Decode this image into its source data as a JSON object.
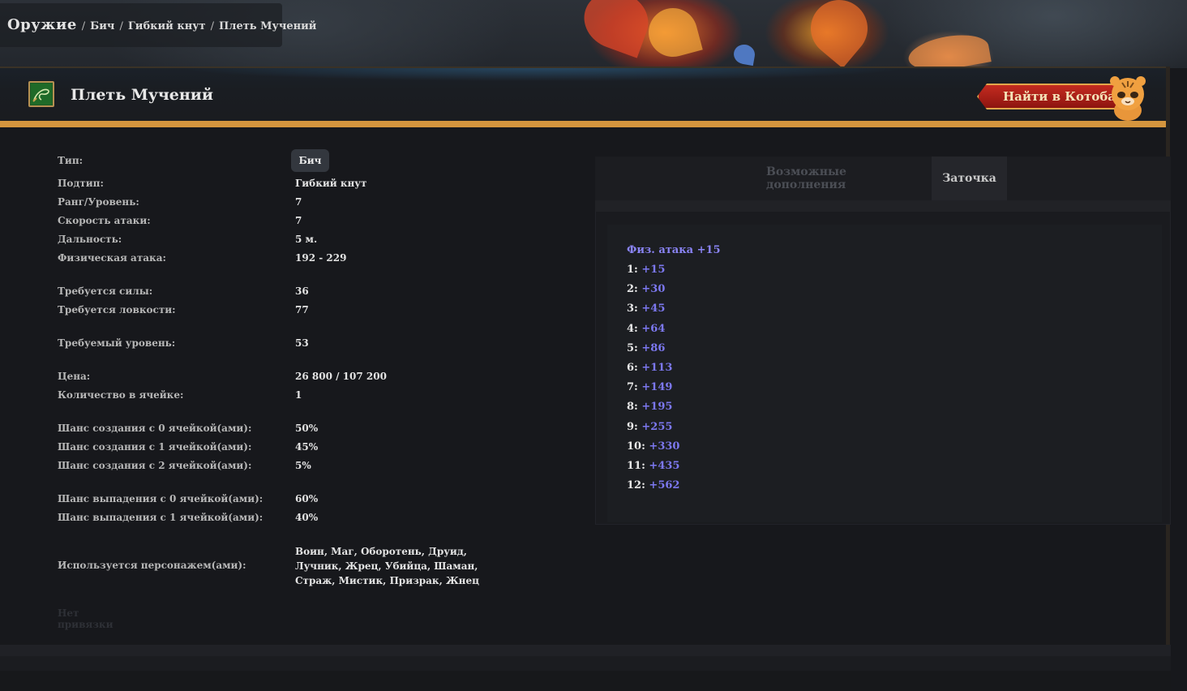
{
  "breadcrumb": {
    "root": "Оружие",
    "items": [
      "Бич",
      "Гибкий кнут",
      "Плеть Мучений"
    ],
    "separator": "/"
  },
  "item": {
    "title": "Плеть Мучений",
    "icon": "whip-item-icon",
    "find_button": "Найти в Котобазе"
  },
  "props": {
    "type_label": "Тип:",
    "type_value": "Бич",
    "subtype_label": "Подтип:",
    "subtype_value": "Гибкий кнут",
    "rank_label": "Ранг/Уровень:",
    "rank_value": "7",
    "speed_label": "Скорость атаки:",
    "speed_value": "7",
    "range_label": "Дальность:",
    "range_value": "5 м.",
    "attack_label": "Физическая атака:",
    "attack_value": "192 - 229",
    "str_label": "Требуется силы:",
    "str_value": "36",
    "agi_label": "Требуется ловкости:",
    "agi_value": "77",
    "level_label": "Требуемый уровень:",
    "level_value": "53",
    "price_label": "Цена:",
    "price_value": "26 800 / 107 200",
    "cell_count_label": "Количество в ячейке:",
    "cell_count_value": "1",
    "craft0_label": "Шанс создания с 0 ячейкой(ами):",
    "craft0_value": "50%",
    "craft1_label": "Шанс создания с 1 ячейкой(ами):",
    "craft1_value": "45%",
    "craft2_label": "Шанс создания с 2 ячейкой(ами):",
    "craft2_value": "5%",
    "drop0_label": "Шанс выпадения с 0 ячейкой(ами):",
    "drop0_value": "60%",
    "drop1_label": "Шанс выпадения с 1 ячейкой(ами):",
    "drop1_value": "40%",
    "classes_label": "Используется персонажем(ами):",
    "classes_value": "Воин, Маг, Оборотень, Друид, Лучник, Жрец, Убийца, Шаман, Страж, Мистик, Призрак, Жнец",
    "binding": "Нет привязки"
  },
  "tabs": {
    "extras": "Возможные дополнения",
    "sharpen": "Заточка",
    "active": "sharpen"
  },
  "sharpening": {
    "header": "Физ. атака +15",
    "levels": [
      {
        "lvl": "1:",
        "bonus": "+15"
      },
      {
        "lvl": "2:",
        "bonus": "+30"
      },
      {
        "lvl": "3:",
        "bonus": "+45"
      },
      {
        "lvl": "4:",
        "bonus": "+64"
      },
      {
        "lvl": "5:",
        "bonus": "+86"
      },
      {
        "lvl": "6:",
        "bonus": "+113"
      },
      {
        "lvl": "7:",
        "bonus": "+149"
      },
      {
        "lvl": "8:",
        "bonus": "+195"
      },
      {
        "lvl": "9:",
        "bonus": "+255"
      },
      {
        "lvl": "10:",
        "bonus": "+330"
      },
      {
        "lvl": "11:",
        "bonus": "+435"
      },
      {
        "lvl": "12:",
        "bonus": "+562"
      }
    ]
  },
  "colors": {
    "accent_gold": "#d5953e",
    "bonus_purple": "#7c78f0",
    "button_red": "#c42b20"
  }
}
